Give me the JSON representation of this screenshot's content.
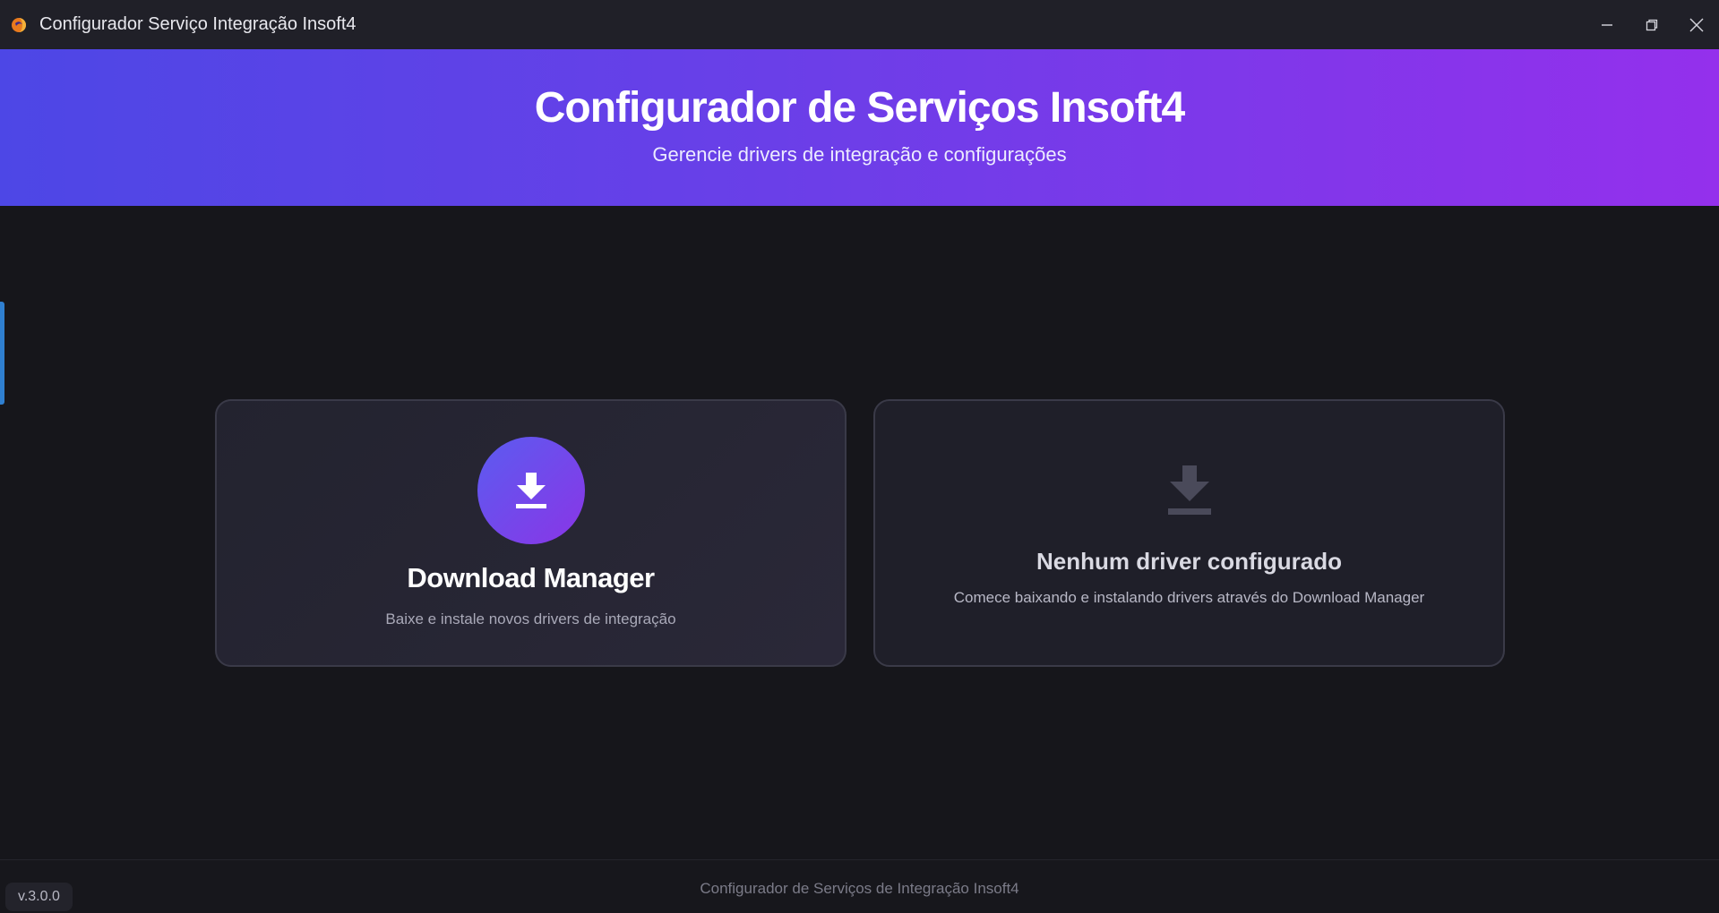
{
  "window": {
    "title": "Configurador Serviço Integração Insoft4",
    "icon": "app-logo-icon"
  },
  "banner": {
    "title": "Configurador de Serviços Insoft4",
    "subtitle": "Gerencie drivers de integração e configurações"
  },
  "cards": {
    "download_manager": {
      "icon": "download-icon",
      "title": "Download Manager",
      "description": "Baixe e instale novos drivers de integração"
    },
    "empty_state": {
      "icon": "download-icon",
      "title": "Nenhum driver configurado",
      "description": "Comece baixando e instalando drivers através do Download Manager"
    }
  },
  "footer": {
    "text": "Configurador de Serviços de Integração Insoft4",
    "version": "v.3.0.0"
  },
  "colors": {
    "banner_start": "#4d47e6",
    "banner_end": "#9430ec",
    "background": "#16161b",
    "titlebar": "#202028",
    "accent_handle": "#2f7fd0"
  }
}
